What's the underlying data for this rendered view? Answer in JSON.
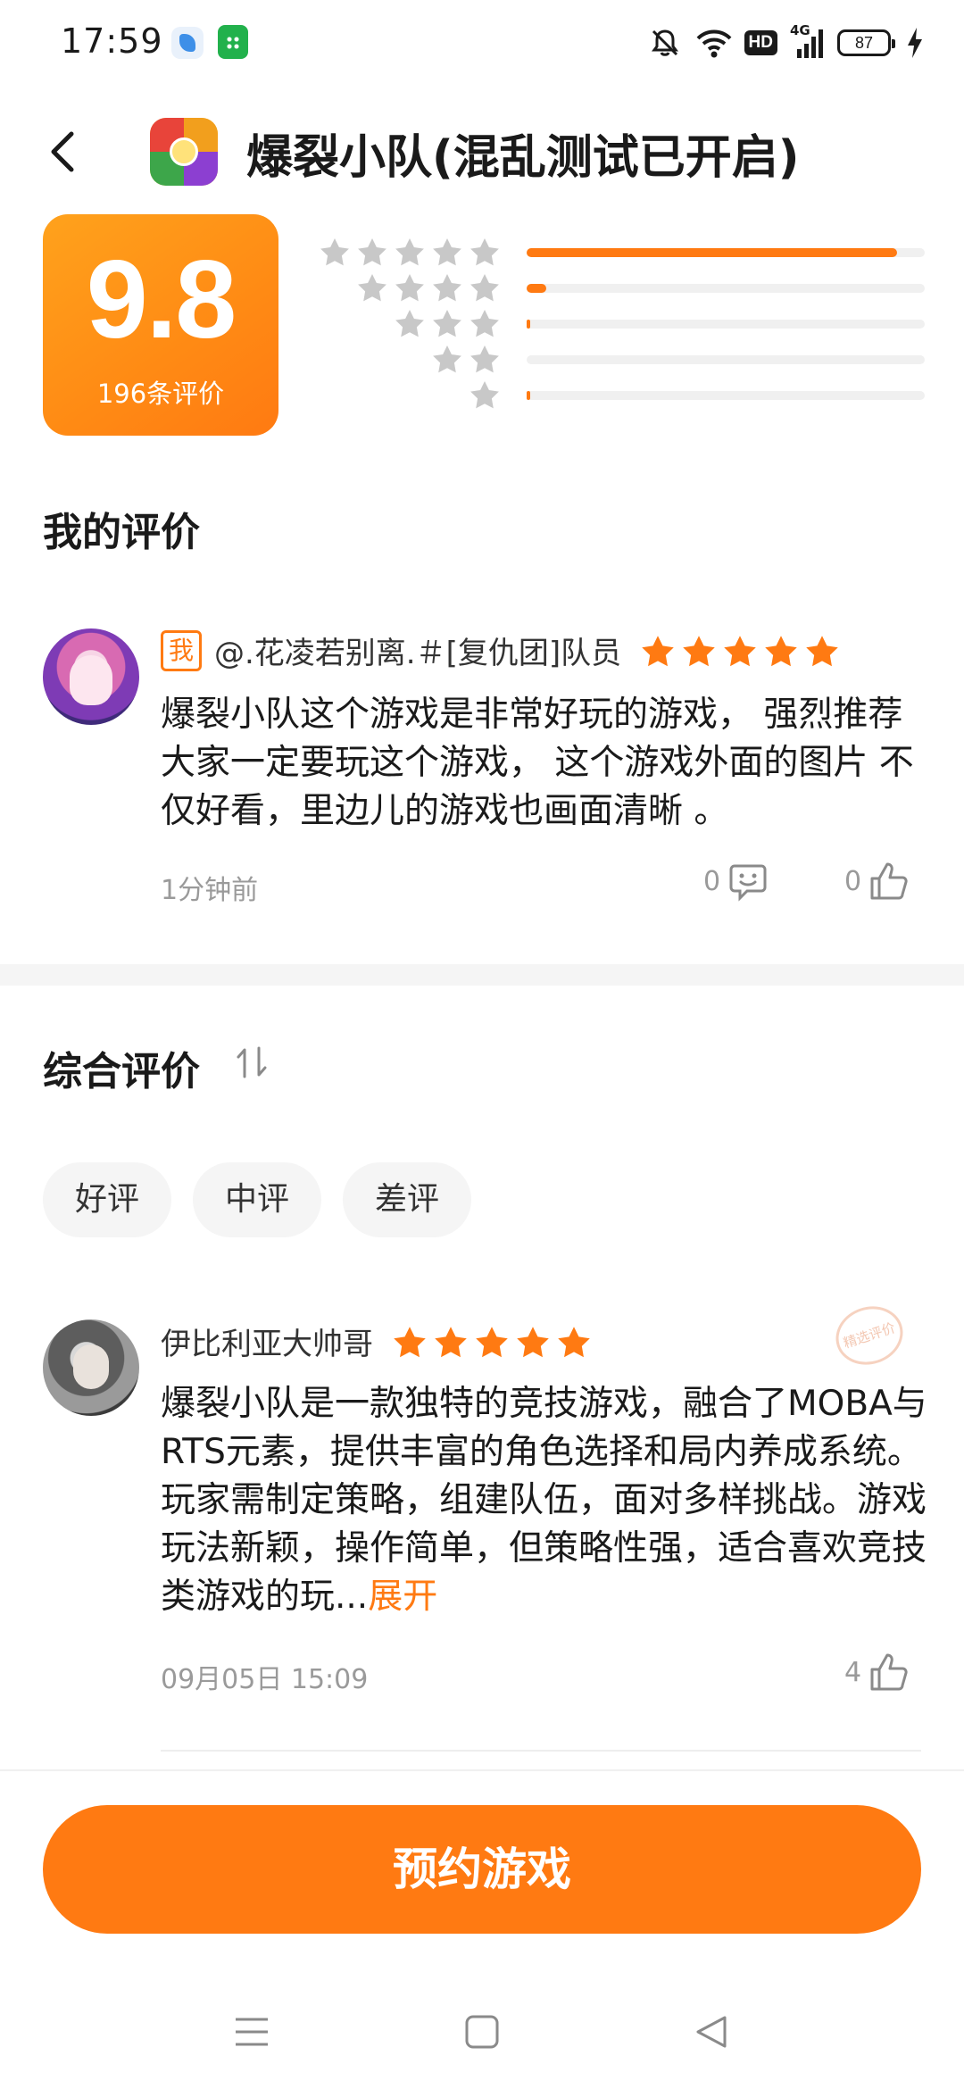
{
  "status_bar": {
    "time": "17:59",
    "hd": "HD",
    "network": "4G",
    "battery": "87"
  },
  "header": {
    "title": "爆裂小队(混乱测试已开启)"
  },
  "rating": {
    "score": "9.8",
    "count_label": "196条评价",
    "distribution": [
      {
        "stars": 5,
        "fraction": 0.93
      },
      {
        "stars": 4,
        "fraction": 0.05
      },
      {
        "stars": 3,
        "fraction": 0.01
      },
      {
        "stars": 2,
        "fraction": 0.0
      },
      {
        "stars": 1,
        "fraction": 0.01
      }
    ]
  },
  "my_review": {
    "section_title": "我的评价",
    "badge": "我",
    "user": "@.花凌若别离.＃[复仇团]队员",
    "stars": 5,
    "text": "爆裂小队这个游戏是非常好玩的游戏， 强烈推荐大家一定要玩这个游戏， 这个游戏外面的图片 不仅好看，里边儿的游戏也画面清晰 。",
    "time": "1分钟前",
    "reply_count": "0",
    "like_count": "0"
  },
  "overall": {
    "section_title": "综合评价",
    "filters": [
      "好评",
      "中评",
      "差评"
    ]
  },
  "reviews": [
    {
      "user": "伊比利亚大帅哥",
      "stars": 5,
      "text": "爆裂小队是一款独特的竞技游戏，融合了MOBA与RTS元素，提供丰富的角色选择和局内养成系统。玩家需制定策略，组建队伍，面对多样挑战。游戏玩法新颖，操作简单，但策略性强，适合喜欢竞技类游戏的玩...",
      "expand_label": "展开",
      "featured_label": "精选评价",
      "time": "09月05日 15:09",
      "like_count": "4"
    }
  ],
  "cta": {
    "label": "预约游戏"
  },
  "colors": {
    "accent": "#ff7a12",
    "star_gray": "#c8c8c8",
    "track": "#f0f0f0"
  },
  "icons": [
    "back-icon",
    "sort-icon",
    "reply-icon",
    "like-icon",
    "menu-icon",
    "home-icon",
    "back-triangle-icon",
    "silent-icon",
    "wifi-icon"
  ]
}
